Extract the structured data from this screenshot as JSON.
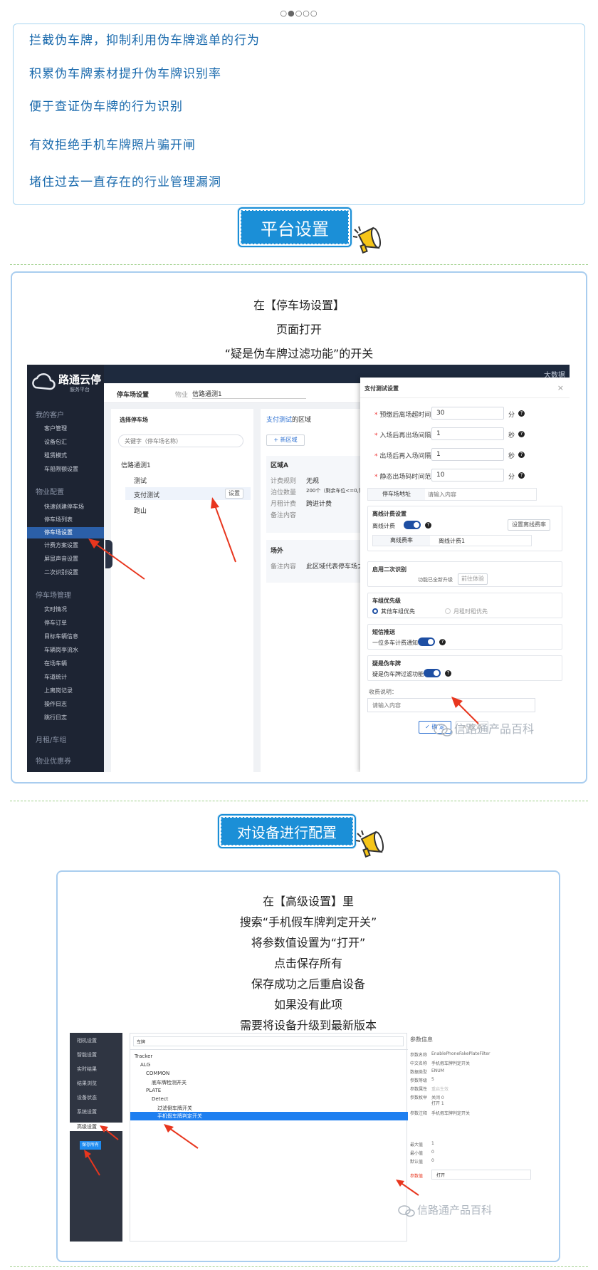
{
  "carousel_dots": "○●○○○",
  "benefits": [
    "拦截伪车牌，抑制利用伪车牌逃单的行为",
    "积累伪车牌素材提升伪车牌识别率",
    "便于查证伪车牌的行为识别",
    "有效拒绝手机车牌照片骗开闸",
    "堵住过去一直存在的行业管理漏洞"
  ],
  "section1": {
    "title": "平台设置",
    "lines": [
      "在【停车场设置】",
      "页面打开",
      "“疑是伪车牌过滤功能”的开关"
    ]
  },
  "shot1": {
    "logo_title": "路通云停",
    "logo_sub": "服务平台",
    "top_right": "大数据",
    "menu": {
      "group1": "我的客户",
      "group1_items": [
        "客户管理",
        "设备包汇",
        "租赁模式",
        "车船限额设置"
      ],
      "group2": "物业配置",
      "group2_items": [
        "快速创建停车场",
        "停车场列表",
        "停车场设置",
        "计费方案设置",
        "屏显声音设置",
        "二次识别设置"
      ],
      "group3": "停车场管理",
      "group3_items": [
        "实时情况",
        "停车订单",
        "目标车辆信息",
        "车辆岗亭流水",
        "在场车辆",
        "车道统计",
        "上离岗记录",
        "操作日志",
        "跳行日志"
      ],
      "group4": "月租/车组",
      "group5": "物业优惠券"
    },
    "breadcrumb": "停车场设置",
    "property_label": "物业",
    "property_value": "信路通测1",
    "tree_title": "选择停车场",
    "tree_search_placeholder": "关键字（停车场名称）",
    "tree_root": "信路通测1",
    "tree_items": [
      "测试",
      "支付测试",
      "跑山"
    ],
    "tree_set_btn": "设置",
    "mid_title_link": "支付测试",
    "mid_title_rest": "的区域",
    "mid_add_btn": "+ 新区域",
    "area_a": "区域A",
    "area_rows": [
      [
        "计费规则",
        "无规"
      ],
      [
        "泊位数量",
        "200个（剩余车位<=0,剩余临时"
      ],
      [
        "月租计费",
        "跨进计费"
      ],
      [
        "备注内容",
        ""
      ]
    ],
    "outside_title": "场外",
    "outside_row": [
      "备注内容",
      "此区域代表停车场之外"
    ],
    "dialog": {
      "title": "支付测试设置",
      "close": "×",
      "fields": [
        {
          "label": "预缴后离场超时间",
          "value": "30",
          "unit": "分"
        },
        {
          "label": "入场后再出场间隔",
          "value": "1",
          "unit": "秒"
        },
        {
          "label": "出场后再入场间隔",
          "value": "1",
          "unit": "秒"
        },
        {
          "label": "静态出场码时间范围",
          "value": "10",
          "unit": "分"
        }
      ],
      "address_label": "停车场地址",
      "address_placeholder": "请输入内容",
      "offline_title": "离线计费设置",
      "offline_label": "离线计费",
      "offline_btn": "设置离线费率",
      "offline_rate_label": "离线费率",
      "offline_rate_value": "离线计费1",
      "second_title": "启用二次识别",
      "second_text": "功能已全新升级",
      "second_btn": "前往体验",
      "priority_title": "车组优先级",
      "priority_opt1": "其他车组优先",
      "priority_opt2": "月租时租优先",
      "sms_title": "短信推送",
      "sms_label": "一位多车计费通知",
      "fake_title": "疑是伪车牌",
      "fake_label": "疑是伪车牌过滤功能",
      "fee_label": "收费说明：",
      "fee_placeholder": "请输入内容",
      "ok": "✓ 确 定",
      "cancel": "× 取 消"
    },
    "watermark": "信路通产品百科"
  },
  "section2": {
    "title": "对设备进行配置",
    "lines": [
      "在【高级设置】里",
      "搜索“手机假车牌判定开关”",
      "将参数值设置为“打开”",
      "点击保存所有",
      "保存成功之后重启设备",
      "如果没有此项",
      "需要将设备升级到最新版本"
    ]
  },
  "shot2": {
    "side_items": [
      "相机设置",
      "智能设置",
      "实时结果",
      "结果浏览",
      "设备状态",
      "系统设置",
      "高级设置"
    ],
    "save_btn": "保存所有",
    "search_value": "车牌",
    "tree": [
      "Tracker",
      "ALG",
      "COMMON",
      "底车牌检测开关",
      "PLATE",
      "Detect",
      "过滤倒车牌开关",
      "手机假车牌判定开关"
    ],
    "info_title": "参数信息",
    "info_rows": [
      [
        "参数名称",
        "EnablePhoneFakePlateFilter"
      ],
      [
        "中文名称",
        "手机假车牌判定开关"
      ],
      [
        "数据类型",
        "ENUM"
      ],
      [
        "参数等级",
        "5"
      ],
      [
        "参数属性",
        "重启生效"
      ],
      [
        "参数枚举",
        "关闭 0"
      ],
      [
        "",
        "打开 1"
      ],
      [
        "参数注释",
        "手机假车牌判定开关"
      ],
      [
        "最大值",
        "1"
      ],
      [
        "最小值",
        "0"
      ],
      [
        "默认值",
        "0"
      ]
    ],
    "value_label": "参数值",
    "value": "打开",
    "watermark": "信路通产品百科"
  },
  "colors": {
    "accent": "#1b8fd7",
    "benefit_text": "#1a6aad",
    "card_border": "#a9cdef",
    "dash": "#9fd08a",
    "arrow": "#e8361e"
  }
}
